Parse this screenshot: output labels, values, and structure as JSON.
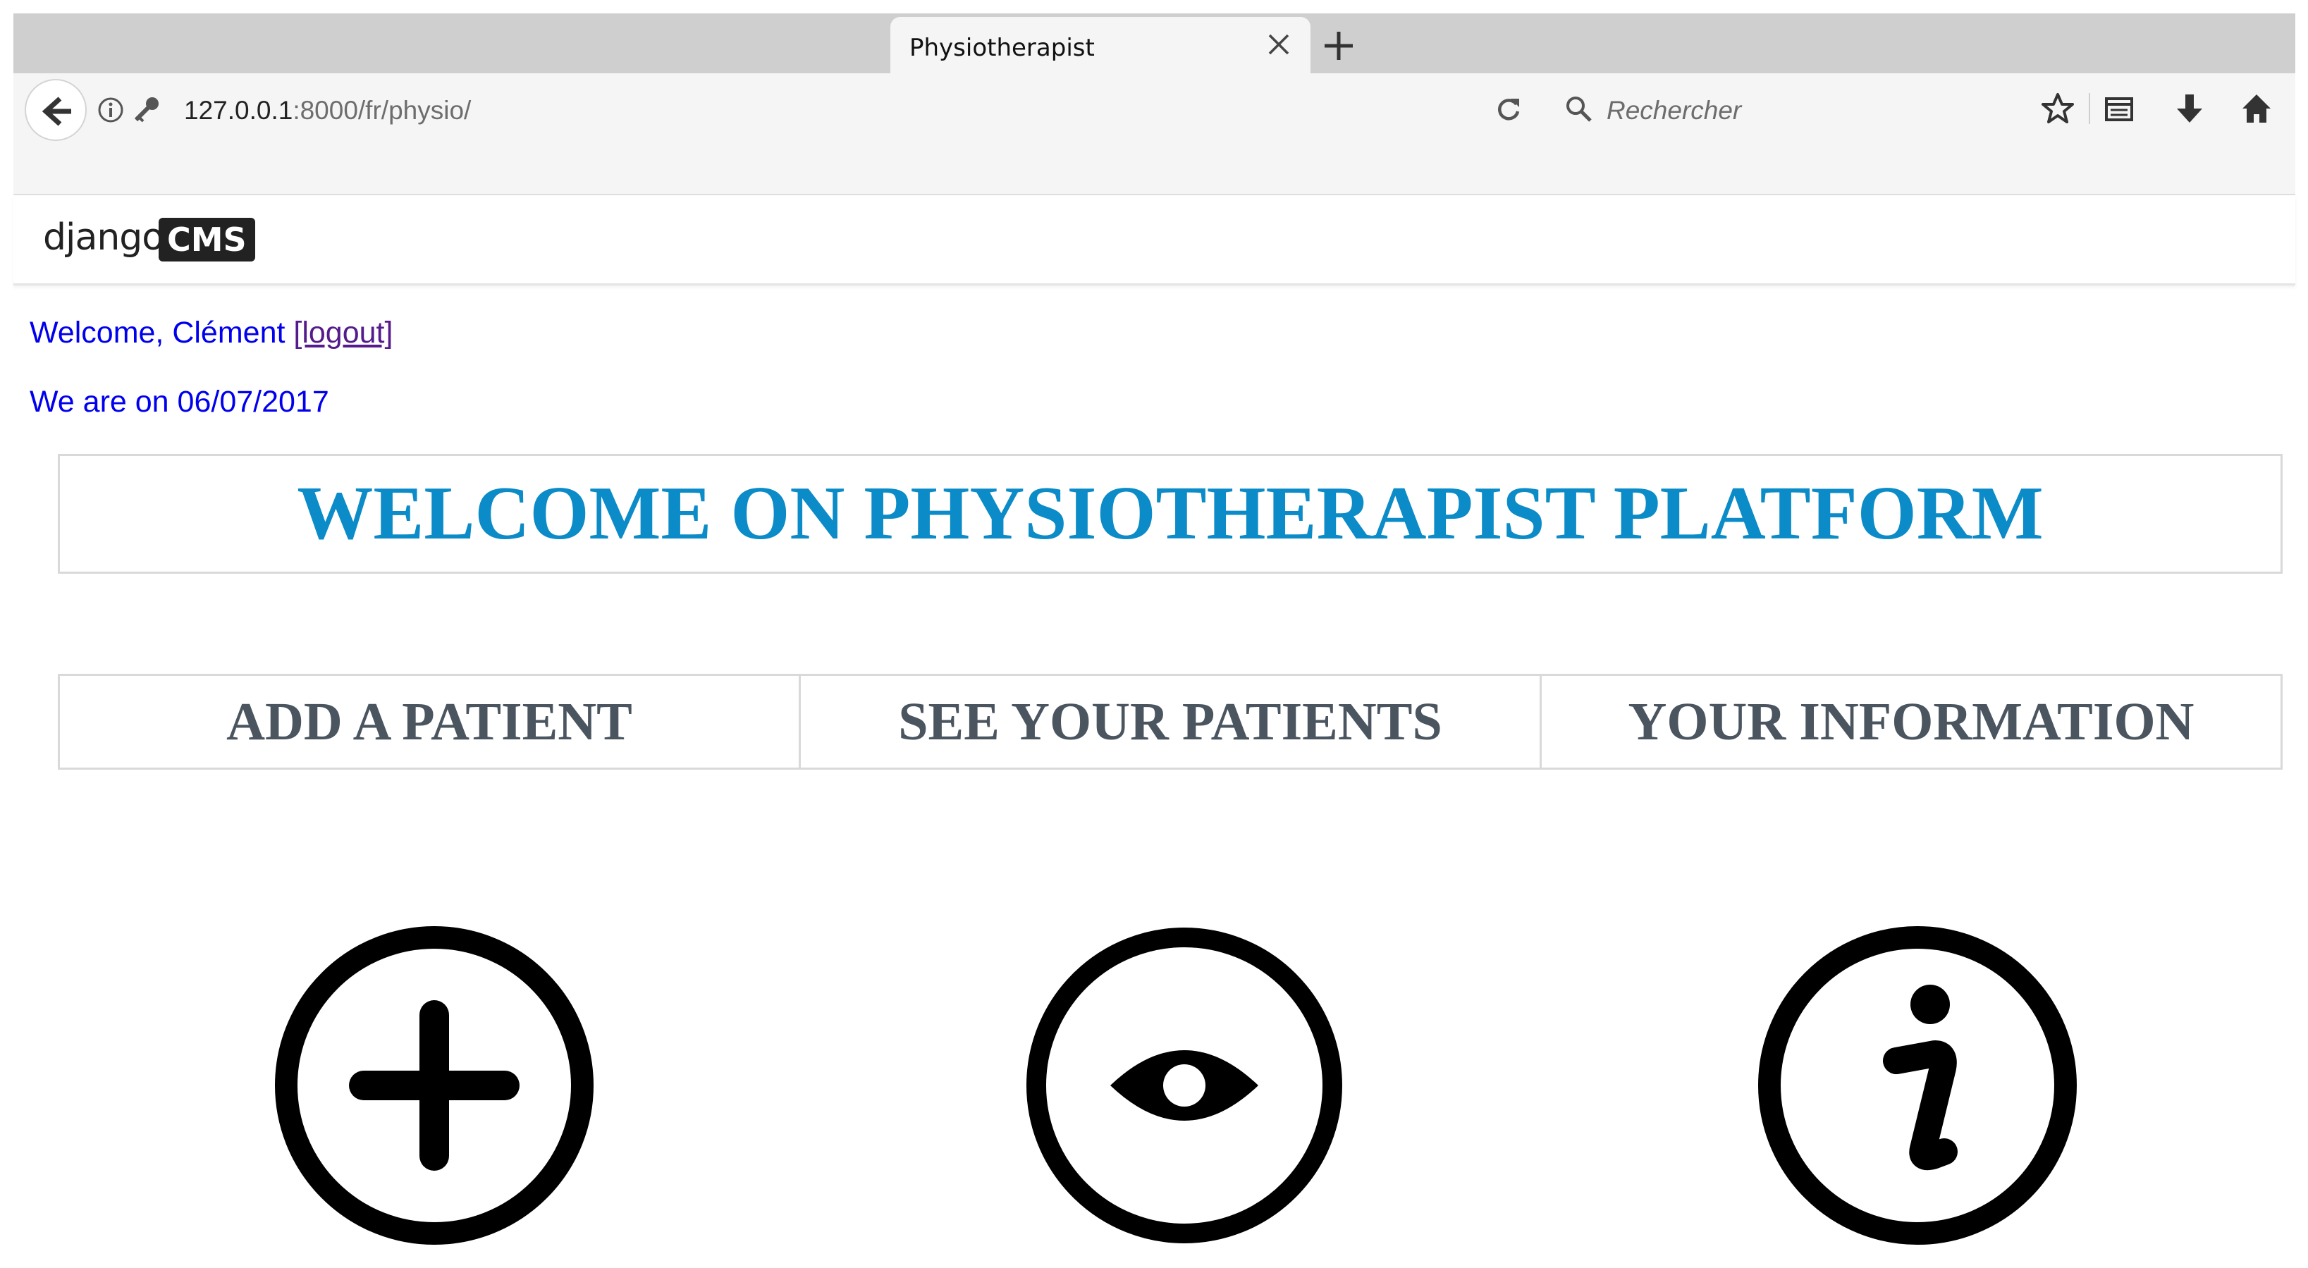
{
  "browser": {
    "tab_title": "Physiotherapist",
    "url_host": "127.0.0.1",
    "url_rest": ":8000/fr/physio/",
    "search_placeholder": "Rechercher"
  },
  "cms": {
    "logo_text": "django",
    "logo_badge": "CMS"
  },
  "page": {
    "welcome_prefix": "Welcome, Clément ",
    "logout_label": "[logout]",
    "date_line": "We are on 06/07/2017",
    "banner_title": "WELCOME ON PHYSIOTHERAPIST PLATFORM",
    "menu": [
      {
        "label": "ADD A PATIENT",
        "icon": "plus-circle-icon"
      },
      {
        "label": "SEE YOUR PATIENTS",
        "icon": "eye-circle-icon"
      },
      {
        "label": "YOUR INFORMATION",
        "icon": "info-circle-icon"
      }
    ]
  },
  "colors": {
    "banner_title": "#0b8bc7",
    "menu_text": "#4a5560",
    "link_blue": "#0000ee",
    "link_visited": "#551a8b"
  }
}
